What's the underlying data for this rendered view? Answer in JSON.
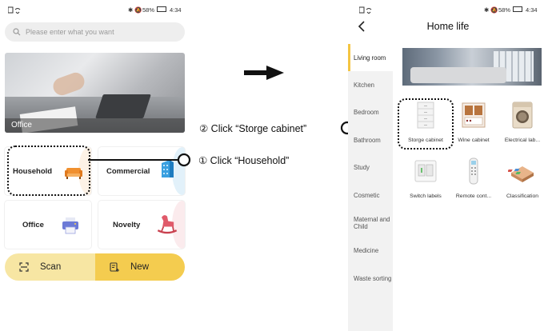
{
  "left_phone": {
    "status": {
      "left_icons": "wifi-icon",
      "right_text": "58%",
      "time": "4:34"
    },
    "search": {
      "placeholder": "Please enter what you want"
    },
    "banner": {
      "caption": "Office"
    },
    "cards": [
      {
        "label": "Household",
        "icon": "sofa-icon",
        "accent": "#f0902f"
      },
      {
        "label": "Commercial",
        "icon": "building-icon",
        "accent": "#3aa0e0"
      },
      {
        "label": "Office",
        "icon": "printer-icon",
        "accent": "#6c7ad6"
      },
      {
        "label": "Novelty",
        "icon": "rocking-horse-icon",
        "accent": "#e05a6a"
      }
    ],
    "bottom": {
      "scan_label": "Scan",
      "new_label": "New"
    }
  },
  "annotations": {
    "step1": "① Click “Household”",
    "step2": "② Click “Storge cabinet”"
  },
  "right_phone": {
    "status": {
      "right_text": "58%",
      "time": "4:34"
    },
    "title": "Home life",
    "sidebar": [
      {
        "label": "Living room",
        "active": true
      },
      {
        "label": "Kitchen"
      },
      {
        "label": "Bedroom"
      },
      {
        "label": "Bathroom"
      },
      {
        "label": "Study"
      },
      {
        "label": "Cosmetic"
      },
      {
        "label": "Maternal and Child"
      },
      {
        "label": "Medicine"
      },
      {
        "label": "Waste sorting"
      }
    ],
    "grid": [
      {
        "label": "Storge cabinet",
        "icon": "cabinet-icon"
      },
      {
        "label": "Wine cabinet",
        "icon": "wine-cabinet-icon"
      },
      {
        "label": "Electrical lab...",
        "icon": "washing-machine-icon"
      },
      {
        "label": "Switch labels",
        "icon": "switch-icon"
      },
      {
        "label": "Remote cont...",
        "icon": "remote-icon"
      },
      {
        "label": "Classification",
        "icon": "classification-icon"
      }
    ]
  },
  "colors": {
    "accent_yellow": "#f4cc4f",
    "scan_yellow": "#f7e6a3",
    "active_bar": "#f4c542"
  }
}
